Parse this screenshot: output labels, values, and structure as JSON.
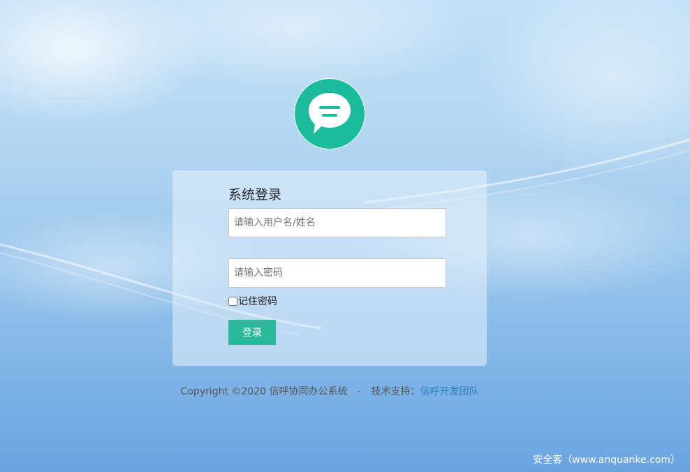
{
  "login": {
    "title": "系统登录",
    "username_placeholder": "请输入用户名/姓名",
    "password_placeholder": "请输入密码",
    "remember_label": "记住密码",
    "submit_label": "登录"
  },
  "footer": {
    "copyright": "Copyright ©2020 信呼协同办公系统",
    "separator": "-",
    "support_label": "技术支持：",
    "support_link": "信呼开发团队"
  },
  "watermark": "安全客（www.anquanke.com）",
  "colors": {
    "accent": "#1abc9c",
    "button": "#2bb89b",
    "link": "#2a7fc4"
  },
  "icons": {
    "logo": "chat-bubble-icon"
  }
}
